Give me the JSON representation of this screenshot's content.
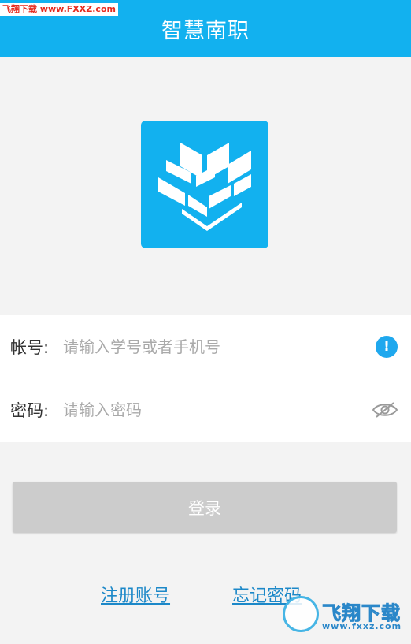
{
  "watermark_top": "飞翔下载 www.FXXZ.com",
  "header": {
    "title": "智慧南职"
  },
  "logo": {
    "icon": "school-shield-logo"
  },
  "form": {
    "account": {
      "label": "帐号:",
      "placeholder": "请输入学号或者手机号",
      "value": ""
    },
    "password": {
      "label": "密码:",
      "placeholder": "请输入密码",
      "value": ""
    }
  },
  "login_button": "登录",
  "links": {
    "register": "注册账号",
    "forgot": "忘记密码"
  },
  "watermark_bottom": {
    "name": "飞翔下载",
    "url": "www.fxxz.com"
  },
  "colors": {
    "header": "#12b1ef",
    "background": "#f3f3f3",
    "login_button": "#cccccc",
    "link": "#1c88c8",
    "info_icon": "#1fa8ee"
  }
}
